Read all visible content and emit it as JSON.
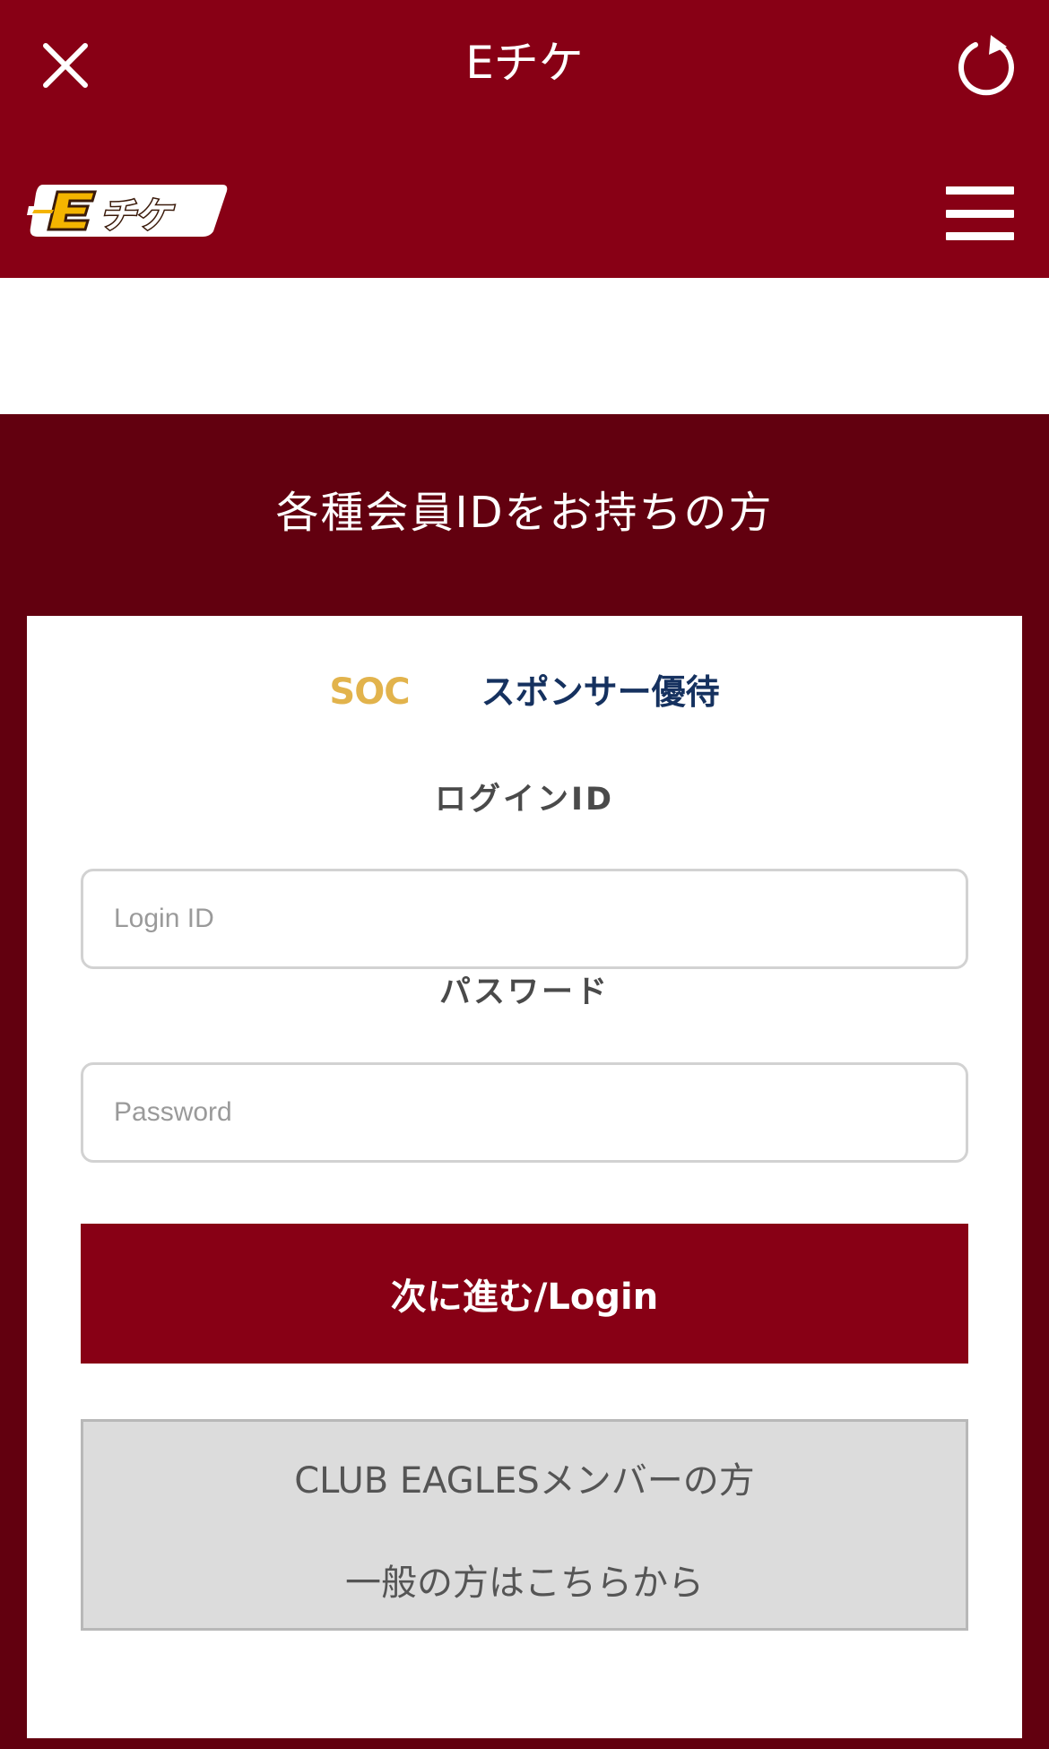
{
  "topbar": {
    "title": "Eチケ"
  },
  "header": {
    "logo_text": "Eチケ"
  },
  "section": {
    "title": "各種会員IDをお持ちの方"
  },
  "tabs": [
    {
      "label": "SOC"
    },
    {
      "label": "スポンサー優待"
    }
  ],
  "form": {
    "login_id_label": "ログインID",
    "login_id_placeholder": "Login ID",
    "password_label": "パスワード",
    "password_placeholder": "Password",
    "submit_label": "次に進む/Login"
  },
  "alt_options": {
    "club_eagles": "CLUB EAGLESメンバーの方",
    "general": "一般の方はこちらから"
  },
  "colors": {
    "brand": "#880015",
    "section_bg": "#62000f",
    "logo_yellow": "#f4b400",
    "soc_gold": "#e2b34c",
    "sponsor_navy": "#15315f"
  }
}
